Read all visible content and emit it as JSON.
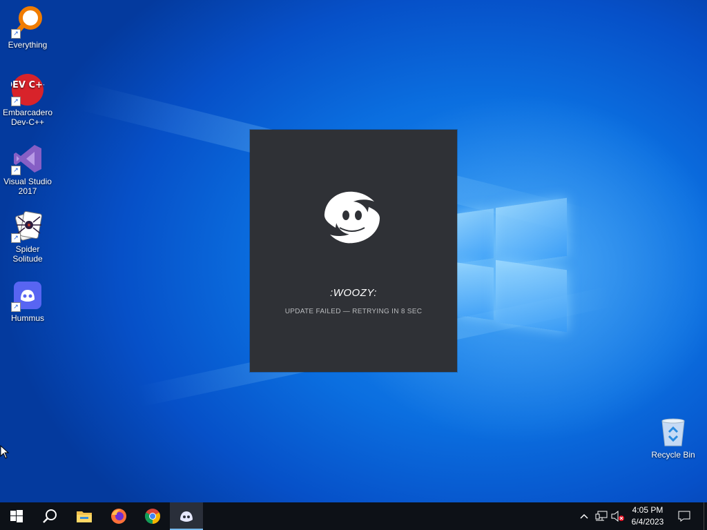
{
  "desktop": {
    "icons": [
      {
        "label": "Everything"
      },
      {
        "label": "Embarcadero Dev-C++"
      },
      {
        "label": "Visual Studio 2017"
      },
      {
        "label": "Spider Solitude"
      },
      {
        "label": "Hummus"
      },
      {
        "label": "Recycle Bin"
      }
    ],
    "devcpp_logo_text": "DEV C++"
  },
  "splash": {
    "title": ":WOOZY:",
    "status": "UPDATE FAILED — RETRYING IN 8 SEC"
  },
  "taskbar": {
    "apps": [
      "start-icon",
      "search-icon",
      "file-explorer-icon",
      "firefox-icon",
      "chrome-icon",
      "discord-icon"
    ],
    "active_app": "discord-icon",
    "clock": {
      "time": "4:05 PM",
      "date": "6/4/2023"
    }
  },
  "colors": {
    "splash_bg": "#2f3136",
    "taskbar_bg": "#0d1117",
    "desktop_blue": "#0b6fe0",
    "discord_blurple": "#5865f2"
  }
}
